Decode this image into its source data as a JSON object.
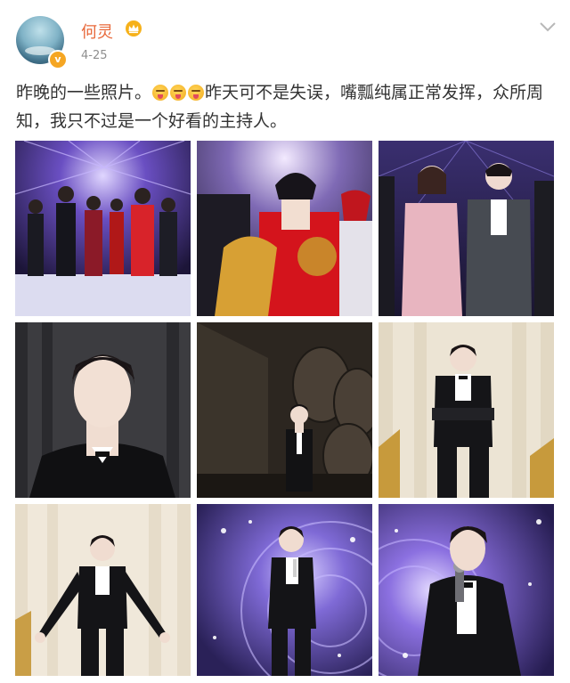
{
  "user": {
    "name": "何灵",
    "time": "4-25",
    "badge": "v"
  },
  "post": {
    "text_before": "昨晚的一些照片。",
    "emoji_name": "tongue-out-emoji",
    "emoji_count": 3,
    "text_after": "昨天可不是失误，嘴瓢纯属正常发挥，众所周知，我只不过是一个好看的主持人。"
  },
  "photos": [
    {
      "name": "photo-1",
      "scene": "group-stage-purple-lights"
    },
    {
      "name": "photo-2",
      "scene": "red-suit-trophy"
    },
    {
      "name": "photo-3",
      "scene": "pink-suit-and-grey-suit-duo"
    },
    {
      "name": "photo-4",
      "scene": "closeup-dark-background"
    },
    {
      "name": "photo-5",
      "scene": "dark-corridor-wheels"
    },
    {
      "name": "photo-6",
      "scene": "arms-crossed-gold-panels"
    },
    {
      "name": "photo-7",
      "scene": "arms-spread-cream-panels"
    },
    {
      "name": "photo-8",
      "scene": "microphone-purple-stage"
    },
    {
      "name": "photo-9",
      "scene": "microphone-closeup-purple-stage"
    }
  ],
  "colors": {
    "username": "#e8683a",
    "verified_badge": "#f5a623",
    "text": "#333333",
    "time": "#8e8e8e"
  }
}
